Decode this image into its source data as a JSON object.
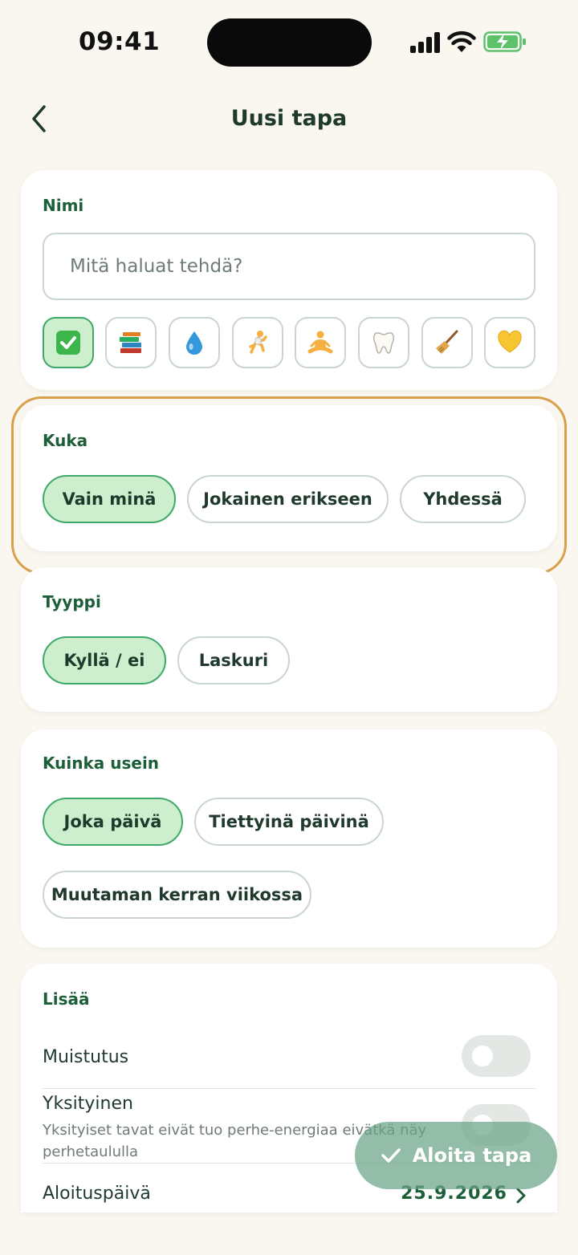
{
  "status_bar": {
    "time": "09:41"
  },
  "header": {
    "title": "Uusi tapa"
  },
  "name_section": {
    "label": "Nimi",
    "input_placeholder": "Mitä haluat tehdä?",
    "input_value": "",
    "emojis": [
      {
        "name": "check-mark-emoji",
        "selected": true
      },
      {
        "name": "books-emoji",
        "selected": false
      },
      {
        "name": "water-drop-emoji",
        "selected": false
      },
      {
        "name": "runner-emoji",
        "selected": false
      },
      {
        "name": "meditation-emoji",
        "selected": false
      },
      {
        "name": "tooth-emoji",
        "selected": false
      },
      {
        "name": "broom-emoji",
        "selected": false
      },
      {
        "name": "yellow-heart-emoji",
        "selected": false
      }
    ]
  },
  "who_section": {
    "label": "Kuka",
    "options": [
      "Vain minä",
      "Jokainen erikseen",
      "Yhdessä"
    ],
    "selected": "Vain minä"
  },
  "type_section": {
    "label": "Tyyppi",
    "options": [
      "Kyllä / ei",
      "Laskuri"
    ],
    "selected": "Kyllä / ei"
  },
  "frequency_section": {
    "label": "Kuinka usein",
    "options": [
      "Joka päivä",
      "Tiettyinä päivinä",
      "Muutaman kerran viikossa"
    ],
    "selected": "Joka päivä"
  },
  "more_section": {
    "label": "Lisää",
    "reminder_label": "Muistutus",
    "reminder_on": false,
    "private_label": "Yksityinen",
    "private_description": "Yksityiset tavat eivät tuo perhe-energiaa eivätkä näy perhetaululla",
    "private_on": false,
    "start_date_label": "Aloituspäivä",
    "start_date_value": "25.9.2026"
  },
  "cta": {
    "label": "Aloita tapa"
  },
  "colors": {
    "accent": "#1b5e38",
    "selected_fill": "#cdefcd",
    "selected_border": "#3fa96a",
    "highlight_ring": "#d9a04a",
    "background": "#f9f7ef"
  }
}
